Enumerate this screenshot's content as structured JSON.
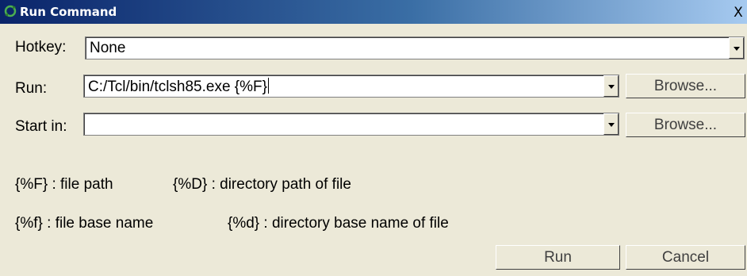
{
  "window": {
    "title": "Run Command",
    "close_label": "X"
  },
  "hotkey": {
    "label": "Hotkey:",
    "value": "None"
  },
  "run": {
    "label": "Run:",
    "value": "C:/Tcl/bin/tclsh85.exe {%F}",
    "browse_label": "Browse..."
  },
  "start_in": {
    "label": "Start in:",
    "value": "",
    "browse_label": "Browse..."
  },
  "help": {
    "line1_left": "{%F} : file path",
    "line1_right": "{%D} : directory path of file",
    "line2_left": "{%f} : file base name",
    "line2_right": "{%d} : directory base name of file"
  },
  "buttons": {
    "run_label": "Run",
    "cancel_label": "Cancel"
  },
  "icons": {
    "app": "refresh-arrows-icon",
    "dropdown": "chevron-down-icon",
    "close": "close-icon"
  }
}
